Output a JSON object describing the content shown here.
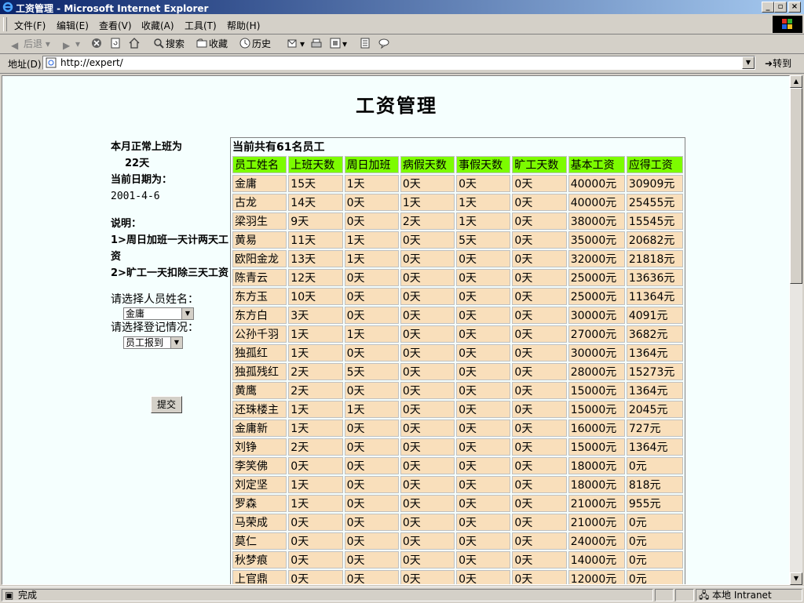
{
  "window": {
    "title": "工资管理 - Microsoft Internet Explorer"
  },
  "menu": [
    "文件(F)",
    "编辑(E)",
    "查看(V)",
    "收藏(A)",
    "工具(T)",
    "帮助(H)"
  ],
  "toolbar": {
    "back": "后退",
    "search": "搜索",
    "favorites": "收藏",
    "history": "历史"
  },
  "address": {
    "label": "地址(D)",
    "url": "http://expert/",
    "go": "转到"
  },
  "page": {
    "title": "工资管理",
    "work_days_label": "本月正常上班为",
    "work_days": "22天",
    "date_label": "当前日期为：",
    "date": "2001-4-6",
    "note_title": "说明：",
    "note1": "1>周日加班一天计两天工资",
    "note2": "2>旷工一天扣除三天工资",
    "select_name_label": "请选择人员姓名：",
    "select_name_value": "金庸",
    "select_status_label": "请选择登记情况：",
    "select_status_value": "员工报到",
    "submit": "提交"
  },
  "table": {
    "caption": "当前共有61名员工",
    "headers": [
      "员工姓名",
      "上班天数",
      "周日加班",
      "病假天数",
      "事假天数",
      "旷工天数",
      "基本工资",
      "应得工资"
    ],
    "rows": [
      [
        "金庸",
        "15天",
        "1天",
        "0天",
        "0天",
        "0天",
        "40000元",
        "30909元"
      ],
      [
        "古龙",
        "14天",
        "0天",
        "1天",
        "1天",
        "0天",
        "40000元",
        "25455元"
      ],
      [
        "梁羽生",
        "9天",
        "0天",
        "2天",
        "1天",
        "0天",
        "38000元",
        "15545元"
      ],
      [
        "黄易",
        "11天",
        "1天",
        "0天",
        "5天",
        "0天",
        "35000元",
        "20682元"
      ],
      [
        "欧阳金龙",
        "13天",
        "1天",
        "0天",
        "0天",
        "0天",
        "32000元",
        "21818元"
      ],
      [
        "陈青云",
        "12天",
        "0天",
        "0天",
        "0天",
        "0天",
        "25000元",
        "13636元"
      ],
      [
        "东方玉",
        "10天",
        "0天",
        "0天",
        "0天",
        "0天",
        "25000元",
        "11364元"
      ],
      [
        "东方白",
        "3天",
        "0天",
        "0天",
        "0天",
        "0天",
        "30000元",
        "4091元"
      ],
      [
        "公孙千羽",
        "1天",
        "1天",
        "0天",
        "0天",
        "0天",
        "27000元",
        "3682元"
      ],
      [
        "独孤红",
        "1天",
        "0天",
        "0天",
        "0天",
        "0天",
        "30000元",
        "1364元"
      ],
      [
        "独孤残红",
        "2天",
        "5天",
        "0天",
        "0天",
        "0天",
        "28000元",
        "15273元"
      ],
      [
        "黄鹰",
        "2天",
        "0天",
        "0天",
        "0天",
        "0天",
        "15000元",
        "1364元"
      ],
      [
        "还珠楼主",
        "1天",
        "1天",
        "0天",
        "0天",
        "0天",
        "15000元",
        "2045元"
      ],
      [
        "金庸新",
        "1天",
        "0天",
        "0天",
        "0天",
        "0天",
        "16000元",
        "727元"
      ],
      [
        "刘铮",
        "2天",
        "0天",
        "0天",
        "0天",
        "0天",
        "15000元",
        "1364元"
      ],
      [
        "李笑佛",
        "0天",
        "0天",
        "0天",
        "0天",
        "0天",
        "18000元",
        "0元"
      ],
      [
        "刘定坚",
        "1天",
        "0天",
        "0天",
        "0天",
        "0天",
        "18000元",
        "818元"
      ],
      [
        "罗森",
        "1天",
        "0天",
        "0天",
        "0天",
        "0天",
        "21000元",
        "955元"
      ],
      [
        "马荣成",
        "0天",
        "0天",
        "0天",
        "0天",
        "0天",
        "21000元",
        "0元"
      ],
      [
        "莫仁",
        "0天",
        "0天",
        "0天",
        "0天",
        "0天",
        "24000元",
        "0元"
      ],
      [
        "秋梦痕",
        "0天",
        "0天",
        "0天",
        "0天",
        "0天",
        "14000元",
        "0元"
      ],
      [
        "上官鼎",
        "0天",
        "0天",
        "0天",
        "0天",
        "0天",
        "12000元",
        "0元"
      ]
    ]
  },
  "status": {
    "text": "完成",
    "zone": "本地 Intranet"
  },
  "colors": {
    "header_bg": "#7cfc00",
    "cell_bg": "#f9dfbb",
    "page_bg": "#f5fffe"
  }
}
